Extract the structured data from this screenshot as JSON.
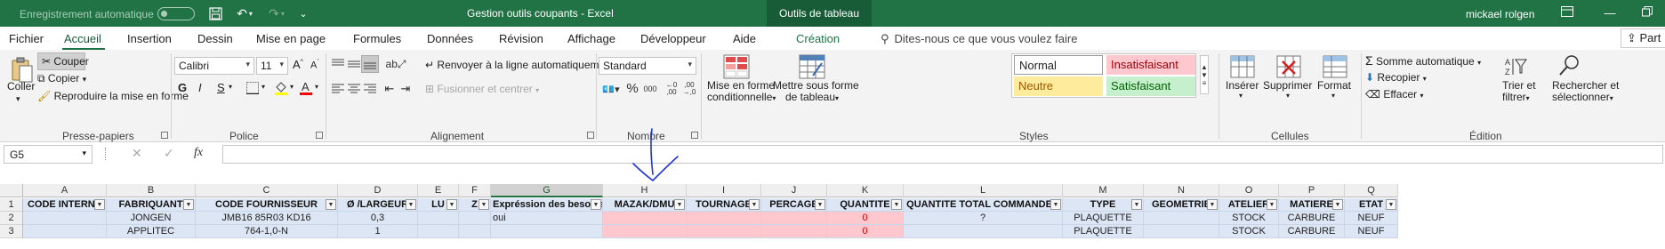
{
  "titlebar": {
    "autosave_label": "Enregistrement automatique",
    "doc_title": "Gestion outils coupants  -  Excel",
    "tool_tab": "Outils de tableau",
    "user": "mickael rolgen"
  },
  "tabs": [
    "Fichier",
    "Accueil",
    "Insertion",
    "Dessin",
    "Mise en page",
    "Formules",
    "Données",
    "Révision",
    "Affichage",
    "Développeur",
    "Aide",
    "Création"
  ],
  "tellme": "Dites-nous ce que vous voulez faire",
  "share": "Part",
  "ribbon": {
    "clipboard": {
      "paste": "Coller",
      "cut": "Couper",
      "copy": "Copier",
      "format_painter": "Reproduire la mise en forme",
      "label": "Presse-papiers"
    },
    "font": {
      "name": "Calibri",
      "size": "11",
      "bold": "G",
      "italic": "I",
      "underline": "S",
      "label": "Police"
    },
    "alignment": {
      "wrap": "Renvoyer à la ligne automatiquement",
      "merge": "Fusionner et centrer",
      "label": "Alignement"
    },
    "number": {
      "format": "Standard",
      "label": "Nombre"
    },
    "styles": {
      "cond_format": [
        "Mise en forme",
        "conditionnelle"
      ],
      "table_format": [
        "Mettre sous forme",
        "de tableau"
      ],
      "normal": "Normal",
      "bad": "Insatisfaisant",
      "neutral": "Neutre",
      "good": "Satisfaisant",
      "label": "Styles"
    },
    "cells": {
      "insert": "Insérer",
      "delete": "Supprimer",
      "format": "Format",
      "label": "Cellules"
    },
    "editing": {
      "autosum": "Somme automatique",
      "fill": "Recopier",
      "clear": "Effacer",
      "sort": [
        "Trier et",
        "filtrer"
      ],
      "find": [
        "Rechercher et",
        "sélectionner"
      ],
      "label": "Édition"
    }
  },
  "formula_bar": {
    "name_box": "G5",
    "fx": "fx",
    "cancel": "✕",
    "enter": "✓",
    "content": ""
  },
  "columns": [
    "A",
    "B",
    "C",
    "D",
    "E",
    "F",
    "G",
    "H",
    "I",
    "J",
    "K",
    "L",
    "M",
    "N",
    "O",
    "P",
    "Q"
  ],
  "selected_column": "G",
  "rows": [
    "1",
    "2",
    "3"
  ],
  "table": {
    "headers": [
      "CODE INTERNE",
      "FABRIQUANT",
      "CODE FOURNISSEUR",
      "Ø /LARGEUR",
      "LU",
      "Z",
      "Expréssion des besoins",
      "MAZAK/DMU",
      "TOURNAGE",
      "PERCAGE",
      "QUANTITE",
      "QUANTITE TOTAL COMMANDER",
      "TYPE",
      "GEOMETRIE",
      "ATELIER",
      "MATIERE",
      "ETAT"
    ],
    "rows": [
      [
        "",
        "JONGEN",
        "JMB16 85R03 KD16",
        "0,3",
        "",
        "",
        "oui",
        "",
        "",
        "",
        "0",
        "?",
        "PLAQUETTE",
        "",
        "STOCK",
        "CARBURE",
        "NEUF"
      ],
      [
        "",
        "APPLITEC",
        "764-1,0-N",
        "1",
        "",
        "",
        "",
        "",
        "",
        "",
        "0",
        "",
        "PLAQUETTE",
        "",
        "STOCK",
        "CARBURE",
        "NEUF"
      ]
    ]
  },
  "colors": {
    "excel_green": "#217346",
    "table_band": "#dde6f4",
    "bad_fill": "#ffc7ce",
    "bad_text": "#9c0006",
    "neutral_fill": "#ffeb9c",
    "good_fill": "#c6efce",
    "annotation": "#1f35d6"
  }
}
